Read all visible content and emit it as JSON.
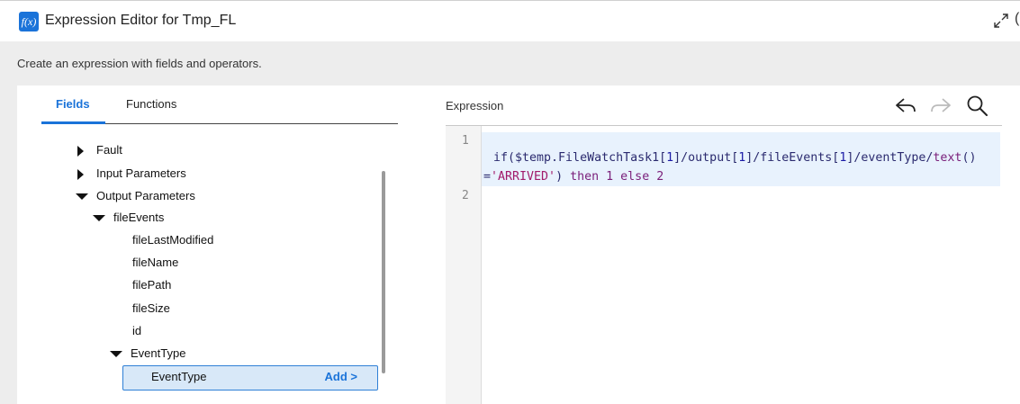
{
  "header": {
    "icon_text": "f(x)",
    "title": "Expression Editor for Tmp_FL"
  },
  "subtitle": "Create an expression with fields and operators.",
  "tabs": [
    {
      "label": "Fields",
      "active": true
    },
    {
      "label": "Functions",
      "active": false
    }
  ],
  "tree": {
    "fault": "Fault",
    "input_parameters": "Input Parameters",
    "output_parameters": "Output Parameters",
    "file_events": "fileEvents",
    "file_last_modified": "fileLastModified",
    "file_name": "fileName",
    "file_path": "filePath",
    "file_size": "fileSize",
    "id": "id",
    "event_type_group": "EventType",
    "event_type_selected": "EventType",
    "add_label": "Add >"
  },
  "expression": {
    "label": "Expression",
    "line_numbers": [
      "1",
      "2"
    ],
    "code": {
      "p1": "if($temp.FileWatchTask1[",
      "n1": "1",
      "p2": "]/output[",
      "n2": "1",
      "p3": "]/fileEvents[",
      "n3": "1",
      "p4": "]/eventType/",
      "fn": "text",
      "p5": "()",
      "eq": "=",
      "str": "'ARRIVED'",
      "p6": ") ",
      "kw_then": "then",
      "sp1": " ",
      "v1": "1",
      "sp2": " ",
      "kw_else": "else",
      "sp3": " ",
      "v2": "2"
    }
  },
  "colors": {
    "accent": "#1a73d9",
    "selected_bg": "#d8e8f8",
    "code_highlight": "#e8f2fd"
  }
}
